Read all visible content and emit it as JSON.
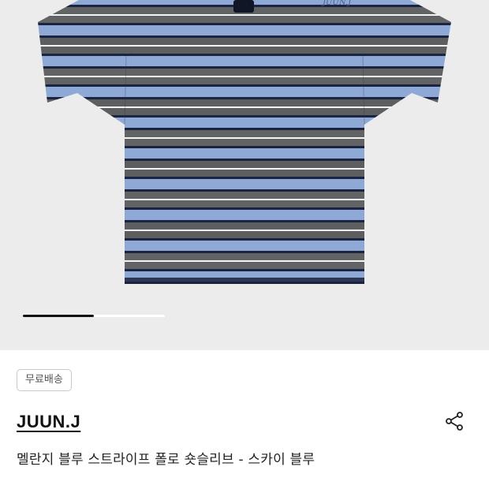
{
  "product": {
    "badge": "무료배송",
    "brand": "JUUN.J",
    "title": "멜란지 블루 스트라이프 폴로 숏슬리브 - 스카이 블루",
    "logo_text": "JUUN.J"
  },
  "gallery": {
    "progress": 0.5
  },
  "colors": {
    "background": "#ececec",
    "stripe_blue": "#8fa9d6",
    "stripe_grey": "#5f6163",
    "stripe_navy": "#1b2440",
    "stripe_white": "#f4f4f4"
  },
  "icons": {
    "share": "share-icon"
  }
}
